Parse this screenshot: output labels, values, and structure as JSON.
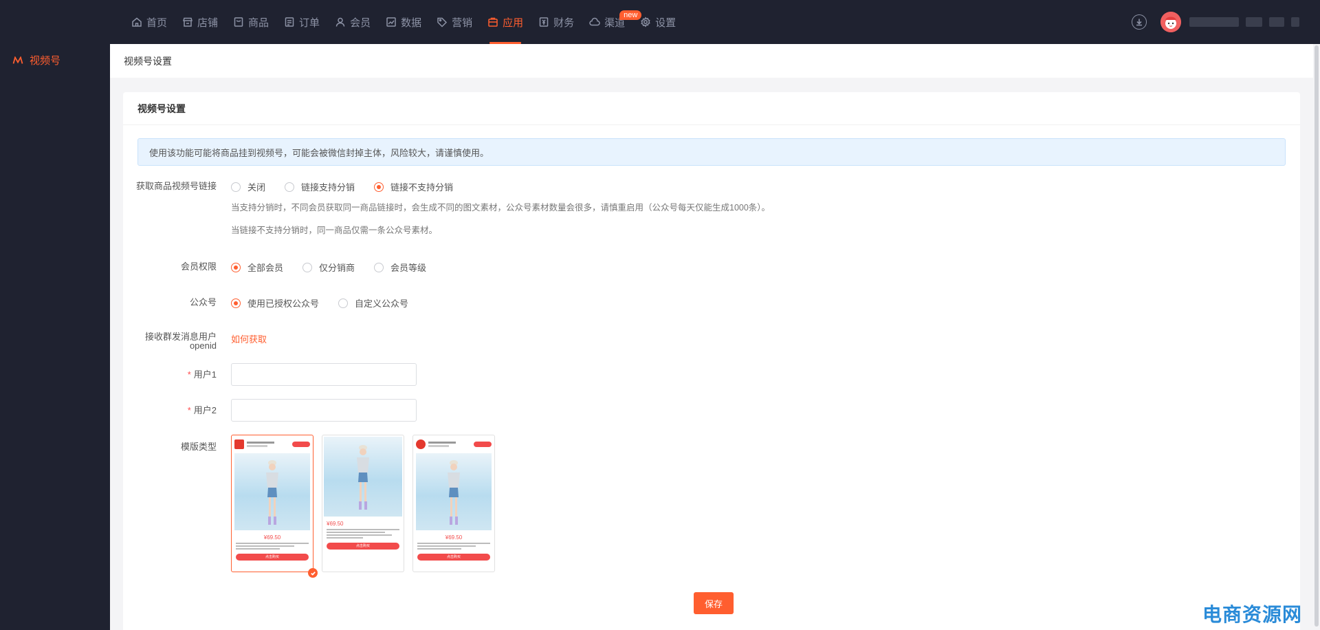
{
  "nav": {
    "items": [
      {
        "label": "首页",
        "icon": "home-icon"
      },
      {
        "label": "店铺",
        "icon": "shop-icon"
      },
      {
        "label": "商品",
        "icon": "goods-icon"
      },
      {
        "label": "订单",
        "icon": "order-icon"
      },
      {
        "label": "会员",
        "icon": "member-icon"
      },
      {
        "label": "数据",
        "icon": "chart-icon"
      },
      {
        "label": "营销",
        "icon": "tag-icon"
      },
      {
        "label": "应用",
        "icon": "app-icon"
      },
      {
        "label": "财务",
        "icon": "finance-icon"
      },
      {
        "label": "渠道",
        "icon": "channel-icon"
      },
      {
        "label": "设置",
        "icon": "gear-icon"
      }
    ],
    "active": "应用",
    "new_badge": "new",
    "accent": "#ff5e2f"
  },
  "sidebar": {
    "item": "视频号"
  },
  "breadcrumb": "视频号设置",
  "card": {
    "title": "视频号设置",
    "alert": "使用该功能可能将商品挂到视频号，可能会被微信封掉主体，风险较大，请谨慎使用。"
  },
  "form": {
    "link": {
      "label": "获取商品视频号链接",
      "options": [
        "关闭",
        "链接支持分销",
        "链接不支持分销"
      ],
      "selected": "链接不支持分销",
      "hint1": "当支持分销时，不同会员获取同一商品链接时，会生成不同的图文素材，公众号素材数量会很多，请慎重启用（公众号每天仅能生成1000条）。",
      "hint2": "当链接不支持分销时，同一商品仅需一条公众号素材。"
    },
    "member": {
      "label": "会员权限",
      "options": [
        "全部会员",
        "仅分销商",
        "会员等级"
      ],
      "selected": "全部会员"
    },
    "official": {
      "label": "公众号",
      "options": [
        "使用已授权公众号",
        "自定义公众号"
      ],
      "selected": "使用已授权公众号"
    },
    "openid": {
      "label_line1": "接收群发消息用户",
      "label_line2": "openid",
      "link": "如何获取"
    },
    "user1": {
      "label": "用户1",
      "value": "",
      "required_mark": "*"
    },
    "user2": {
      "label": "用户2",
      "value": "",
      "required_mark": "*"
    },
    "template": {
      "label": "模版类型",
      "count": 3,
      "selected_index": 0,
      "price": "¥69.50",
      "buy": "点击购买"
    },
    "save": "保存"
  },
  "watermark": "电商资源网"
}
